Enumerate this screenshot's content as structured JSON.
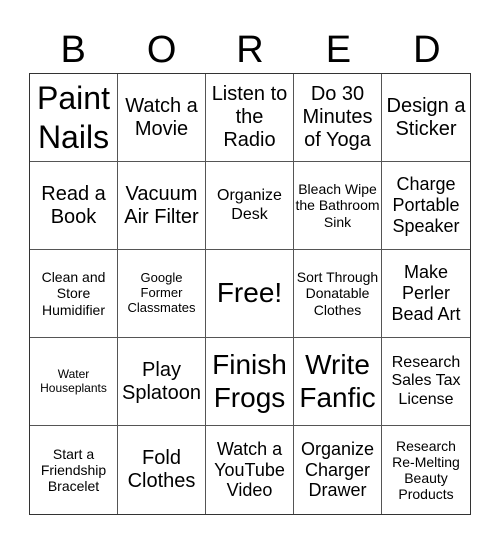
{
  "header": {
    "letters": [
      "B",
      "O",
      "R",
      "E",
      "D"
    ]
  },
  "cells": [
    {
      "text": "Paint Nails"
    },
    {
      "text": "Watch a Movie"
    },
    {
      "text": "Listen to the Radio"
    },
    {
      "text": "Do 30 Minutes of Yoga"
    },
    {
      "text": "Design a Sticker"
    },
    {
      "text": "Read a Book"
    },
    {
      "text": "Vacuum Air Filter"
    },
    {
      "text": "Organize Desk"
    },
    {
      "text": "Bleach Wipe the Bathroom Sink"
    },
    {
      "text": "Charge Portable Speaker"
    },
    {
      "text": "Clean and Store Humidifier"
    },
    {
      "text": "Google Former Classmates"
    },
    {
      "text": "Free!"
    },
    {
      "text": "Sort Through Donatable Clothes"
    },
    {
      "text": "Make Perler Bead Art"
    },
    {
      "text": "Water Houseplants"
    },
    {
      "text": "Play Splatoon"
    },
    {
      "text": "Finish Frogs"
    },
    {
      "text": "Write Fanfic"
    },
    {
      "text": "Research Sales Tax License"
    },
    {
      "text": "Start a Friendship Bracelet"
    },
    {
      "text": "Fold Clothes"
    },
    {
      "text": "Watch a YouTube Video"
    },
    {
      "text": "Organize Charger Drawer"
    },
    {
      "text": "Research Re-Melting Beauty Products"
    }
  ]
}
